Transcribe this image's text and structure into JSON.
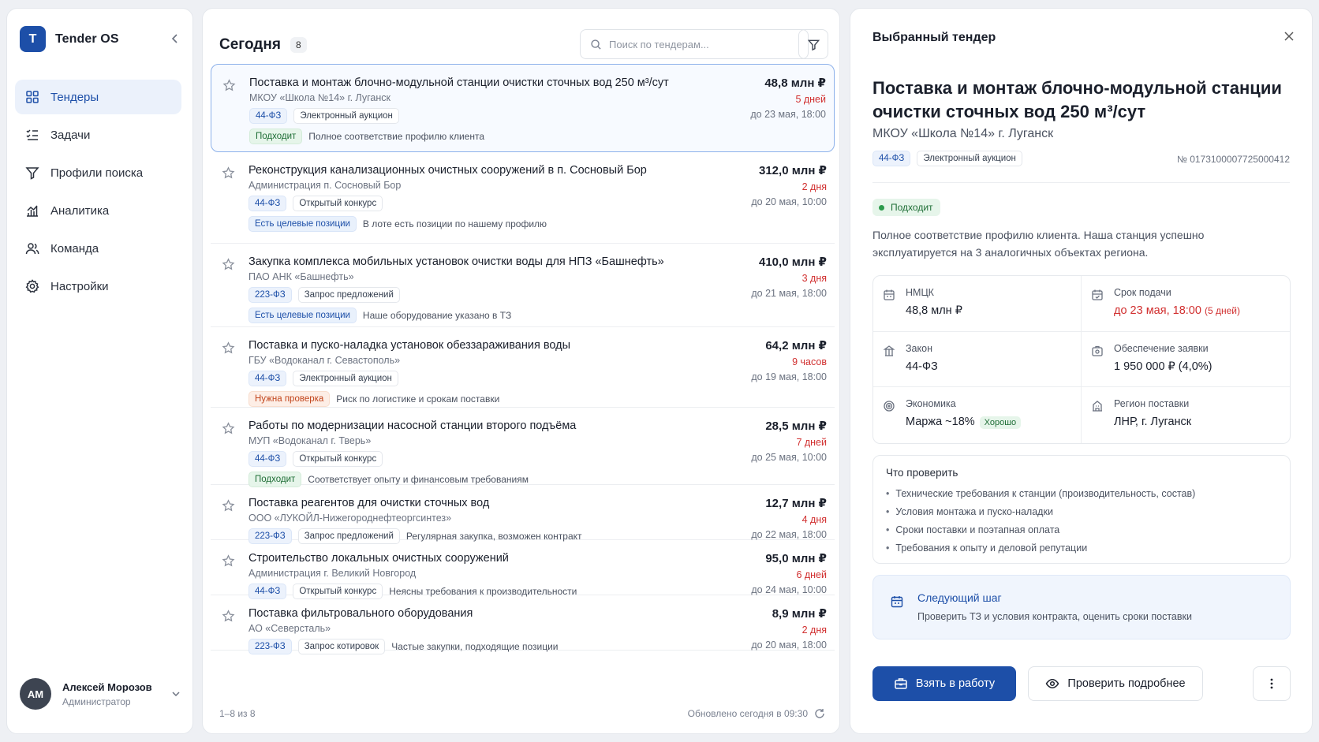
{
  "app": {
    "logo_letter": "T",
    "name": "Tender OS"
  },
  "nav": [
    {
      "label": "Тендеры",
      "icon": "grid-icon"
    },
    {
      "label": "Задачи",
      "icon": "tasks-icon"
    },
    {
      "label": "Профили поиска",
      "icon": "filter-icon"
    },
    {
      "label": "Аналитика",
      "icon": "chart-icon"
    },
    {
      "label": "Команда",
      "icon": "users-icon"
    },
    {
      "label": "Настройки",
      "icon": "gear-icon"
    }
  ],
  "user": {
    "initials": "АМ",
    "name": "Алексей Морозов",
    "role": "Администратор"
  },
  "list": {
    "title": "Сегодня",
    "count": "8",
    "search_placeholder": "Поиск по тендерам...",
    "footer_range": "1–8 из 8",
    "footer_updated": "Обновлено сегодня в 09:30",
    "rows": [
      {
        "title": "Поставка и монтаж блочно-модульной станции очистки сточных вод 250 м³/сут",
        "org": "МКОУ «Школа №14» г. Луганск",
        "law": "44-ФЗ",
        "method": "Электронный аукцион",
        "badge": "Подходит",
        "badge_type": "good",
        "note": "Полное соответствие профилю клиента",
        "price": "48,8 млн ₽",
        "days": "5 дней",
        "deadline": "до 23 мая, 18:00",
        "selected": true
      },
      {
        "title": "Реконструкция канализационных очистных сооружений в п. Сосновый Бор",
        "org": "Администрация п. Сосновый Бор",
        "law": "44-ФЗ",
        "method": "Открытый конкурс",
        "badge": "Есть целевые позиции",
        "badge_type": "target",
        "note": "В лоте есть позиции по нашему профилю",
        "price": "312,0 млн ₽",
        "days": "2 дня",
        "deadline": "до 20 мая, 10:00"
      },
      {
        "title": "Закупка комплекса мобильных установок очистки воды для НПЗ «Башнефть»",
        "org": "ПАО АНК «Башнефть»",
        "law": "223-ФЗ",
        "method": "Запрос предложений",
        "badge": "Есть целевые позиции",
        "badge_type": "target",
        "note": "Наше оборудование указано в ТЗ",
        "price": "410,0 млн ₽",
        "days": "3 дня",
        "deadline": "до 21 мая, 18:00"
      },
      {
        "title": "Поставка и пуско-наладка установок обеззараживания воды",
        "org": "ГБУ «Водоканал г. Севастополь»",
        "law": "44-ФЗ",
        "method": "Электронный аукцион",
        "badge": "Нужна проверка",
        "badge_type": "warn",
        "note": "Риск по логистике и срокам поставки",
        "price": "64,2 млн ₽",
        "days": "9 часов",
        "deadline": "до 19 мая, 18:00"
      },
      {
        "title": "Работы по модернизации насосной станции второго подъёма",
        "org": "МУП «Водоканал г. Тверь»",
        "law": "44-ФЗ",
        "method": "Открытый конкурс",
        "badge": "Подходит",
        "badge_type": "good",
        "note": "Соответствует опыту и финансовым требованиям",
        "price": "28,5 млн ₽",
        "days": "7 дней",
        "deadline": "до 25 мая, 10:00"
      },
      {
        "title": "Поставка реагентов для очистки сточных вод",
        "org": "ООО «ЛУКОЙЛ-Нижегороднефтеоргсинтез»",
        "law": "223-ФЗ",
        "method": "Запрос предложений",
        "badge": "",
        "badge_type": "",
        "note": "Регулярная закупка, возможен контракт",
        "price": "12,7 млн ₽",
        "days": "4 дня",
        "deadline": "до 22 мая, 18:00"
      },
      {
        "title": "Строительство локальных очистных сооружений",
        "org": "Администрация г. Великий Новгород",
        "law": "44-ФЗ",
        "method": "Открытый конкурс",
        "badge": "",
        "badge_type": "",
        "note": "Неясны требования к производительности",
        "price": "95,0 млн ₽",
        "days": "6 дней",
        "deadline": "до 24 мая, 10:00"
      },
      {
        "title": "Поставка фильтровального оборудования",
        "org": "АО «Северсталь»",
        "law": "223-ФЗ",
        "method": "Запрос котировок",
        "badge": "",
        "badge_type": "",
        "note": "Частые закупки, подходящие позиции",
        "price": "8,9 млн ₽",
        "days": "2 дня",
        "deadline": "до 20 мая, 18:00"
      }
    ]
  },
  "detail": {
    "header": "Выбранный тендер",
    "title": "Поставка и монтаж блочно-модульной станции очистки сточных вод 250 м³/сут",
    "org": "МКОУ «Школа №14» г. Луганск",
    "law": "44-ФЗ",
    "method": "Электронный аукцион",
    "number": "№ 0173100007725000412",
    "badge": "Подходит",
    "description": "Полное соответствие профилю клиента. Наша станция успешно эксплуатируется на 3 аналогичных объектах региона.",
    "facts": {
      "nmck_label": "НМЦК",
      "nmck_value": "48,8 млн ₽",
      "deadline_label": "Срок подачи",
      "deadline_value": "до 23 мая, 18:00",
      "deadline_left": "(5 дней)",
      "law_label": "Закон",
      "law_value": "44-ФЗ",
      "security_label": "Обеспечение заявки",
      "security_value": "1 950 000 ₽ (4,0%)",
      "economy_label": "Экономика",
      "economy_value": "Маржа ~18%",
      "economy_badge": "Хорошо",
      "region_label": "Регион поставки",
      "region_value": "ЛНР, г. Луганск"
    },
    "check_title": "Что проверить",
    "check_items": [
      "Технические требования к станции (производительность, состав)",
      "Условия монтажа и пуско-наладки",
      "Сроки поставки и поэтапная оплата",
      "Требования к опыту и деловой репутации"
    ],
    "next_title": "Следующий шаг",
    "next_text": "Проверить ТЗ и условия контракта, оценить сроки поставки",
    "btn_take": "Взять в работу",
    "btn_check": "Проверить подробнее"
  },
  "colors": {
    "accent": "#1d4fa8",
    "danger": "#d12f2f",
    "success": "#1f6e36",
    "warning": "#c2451c"
  }
}
